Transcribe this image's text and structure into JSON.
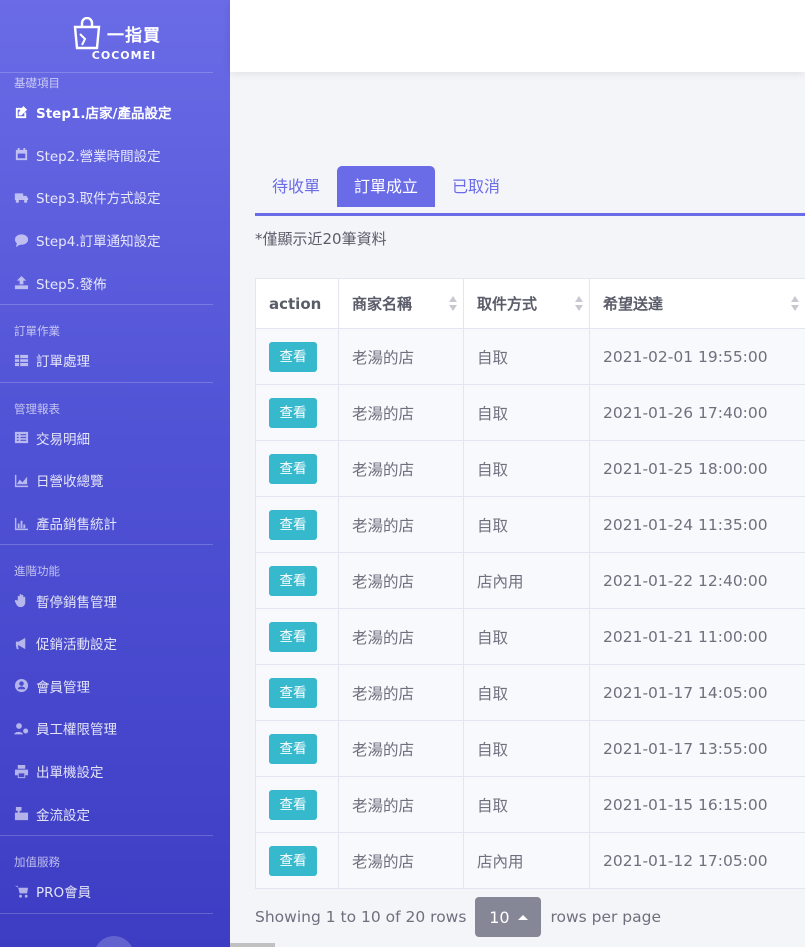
{
  "brand": {
    "name": "一指買",
    "sub": "COCOMEI"
  },
  "sidebar": {
    "sections": [
      {
        "title": "基礎項目",
        "items": [
          {
            "label": "Step1.店家/產品設定",
            "icon": "edit-icon",
            "active": true
          },
          {
            "label": "Step2.營業時間設定",
            "icon": "calendar-icon"
          },
          {
            "label": "Step3.取件方式設定",
            "icon": "truck-icon"
          },
          {
            "label": "Step4.訂單通知設定",
            "icon": "chat-icon"
          },
          {
            "label": "Step5.發佈",
            "icon": "upload-icon"
          }
        ]
      },
      {
        "title": "訂單作業",
        "items": [
          {
            "label": "訂單處理",
            "icon": "table-icon"
          }
        ]
      },
      {
        "title": "管理報表",
        "items": [
          {
            "label": "交易明細",
            "icon": "list-icon"
          },
          {
            "label": "日營收總覽",
            "icon": "area-chart-icon"
          },
          {
            "label": "產品銷售統計",
            "icon": "bar-chart-icon"
          }
        ]
      },
      {
        "title": "進階功能",
        "items": [
          {
            "label": "暫停銷售管理",
            "icon": "hand-icon"
          },
          {
            "label": "促銷活動設定",
            "icon": "megaphone-icon"
          },
          {
            "label": "會員管理",
            "icon": "user-circle-icon"
          },
          {
            "label": "員工權限管理",
            "icon": "user-gear-icon"
          },
          {
            "label": "出單機設定",
            "icon": "printer-icon"
          },
          {
            "label": "金流設定",
            "icon": "cash-register-icon"
          }
        ]
      },
      {
        "title": "加值服務",
        "items": [
          {
            "label": "PRO會員",
            "icon": "cart-icon"
          }
        ]
      }
    ]
  },
  "tabs": [
    {
      "label": "待收單",
      "active": false
    },
    {
      "label": "訂單成立",
      "active": true
    },
    {
      "label": "已取消",
      "active": false
    }
  ],
  "note": "*僅顯示近20筆資料",
  "table": {
    "columns": [
      "action",
      "商家名稱",
      "取件方式",
      "希望送達"
    ],
    "view_label": "查看",
    "rows": [
      {
        "store": "老湯的店",
        "pickup": "自取",
        "time": "2021-02-01 19:55:00"
      },
      {
        "store": "老湯的店",
        "pickup": "自取",
        "time": "2021-01-26 17:40:00"
      },
      {
        "store": "老湯的店",
        "pickup": "自取",
        "time": "2021-01-25 18:00:00"
      },
      {
        "store": "老湯的店",
        "pickup": "自取",
        "time": "2021-01-24 11:35:00"
      },
      {
        "store": "老湯的店",
        "pickup": "店內用",
        "time": "2021-01-22 12:40:00"
      },
      {
        "store": "老湯的店",
        "pickup": "自取",
        "time": "2021-01-21 11:00:00"
      },
      {
        "store": "老湯的店",
        "pickup": "自取",
        "time": "2021-01-17 14:05:00"
      },
      {
        "store": "老湯的店",
        "pickup": "自取",
        "time": "2021-01-17 13:55:00"
      },
      {
        "store": "老湯的店",
        "pickup": "自取",
        "time": "2021-01-15 16:15:00"
      },
      {
        "store": "老湯的店",
        "pickup": "店內用",
        "time": "2021-01-12 17:05:00"
      }
    ]
  },
  "pager": {
    "showing": "Showing 1 to 10 of 20 rows",
    "page_size": "10",
    "suffix": "rows per page"
  },
  "colors": {
    "primary": "#6a6be6",
    "info": "#36b9cc",
    "secondary": "#858796"
  }
}
